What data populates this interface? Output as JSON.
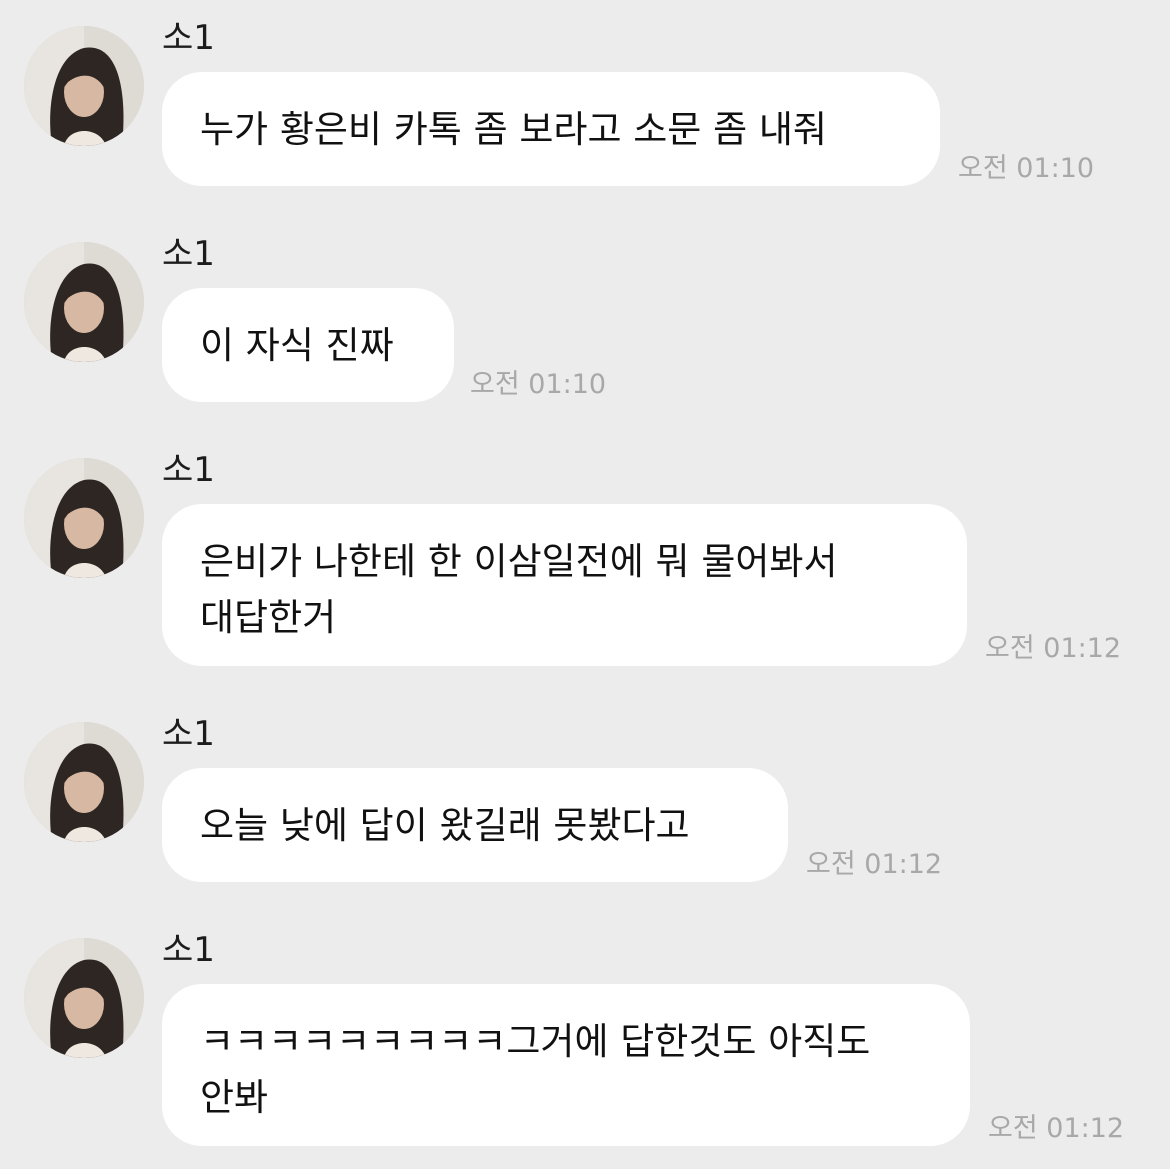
{
  "messages": [
    {
      "sender": "소1",
      "lines": [
        "누가 황은비 카톡 좀 보라고 소문 좀 내줘"
      ],
      "time": "오전 01:10"
    },
    {
      "sender": "소1",
      "lines": [
        "이 자식 진짜"
      ],
      "time": "오전 01:10"
    },
    {
      "sender": "소1",
      "lines": [
        "은비가 나한테 한 이삼일전에 뭐 물어봐서",
        "대답한거"
      ],
      "time": "오전 01:12"
    },
    {
      "sender": "소1",
      "lines": [
        "오늘 낮에 답이 왔길래 못봤다고"
      ],
      "time": "오전 01:12"
    },
    {
      "sender": "소1",
      "lines": [
        "ㅋㅋㅋㅋㅋㅋㅋㅋㅋ그거에 답한것도 아직도",
        "안봐"
      ],
      "time": "오전 01:12"
    }
  ],
  "colors": {
    "background": "#ececec",
    "bubble": "#ffffff",
    "timestamp": "#a8a8a8",
    "text": "#111111"
  },
  "icons": {
    "avatar": "profile-photo-avatar"
  }
}
